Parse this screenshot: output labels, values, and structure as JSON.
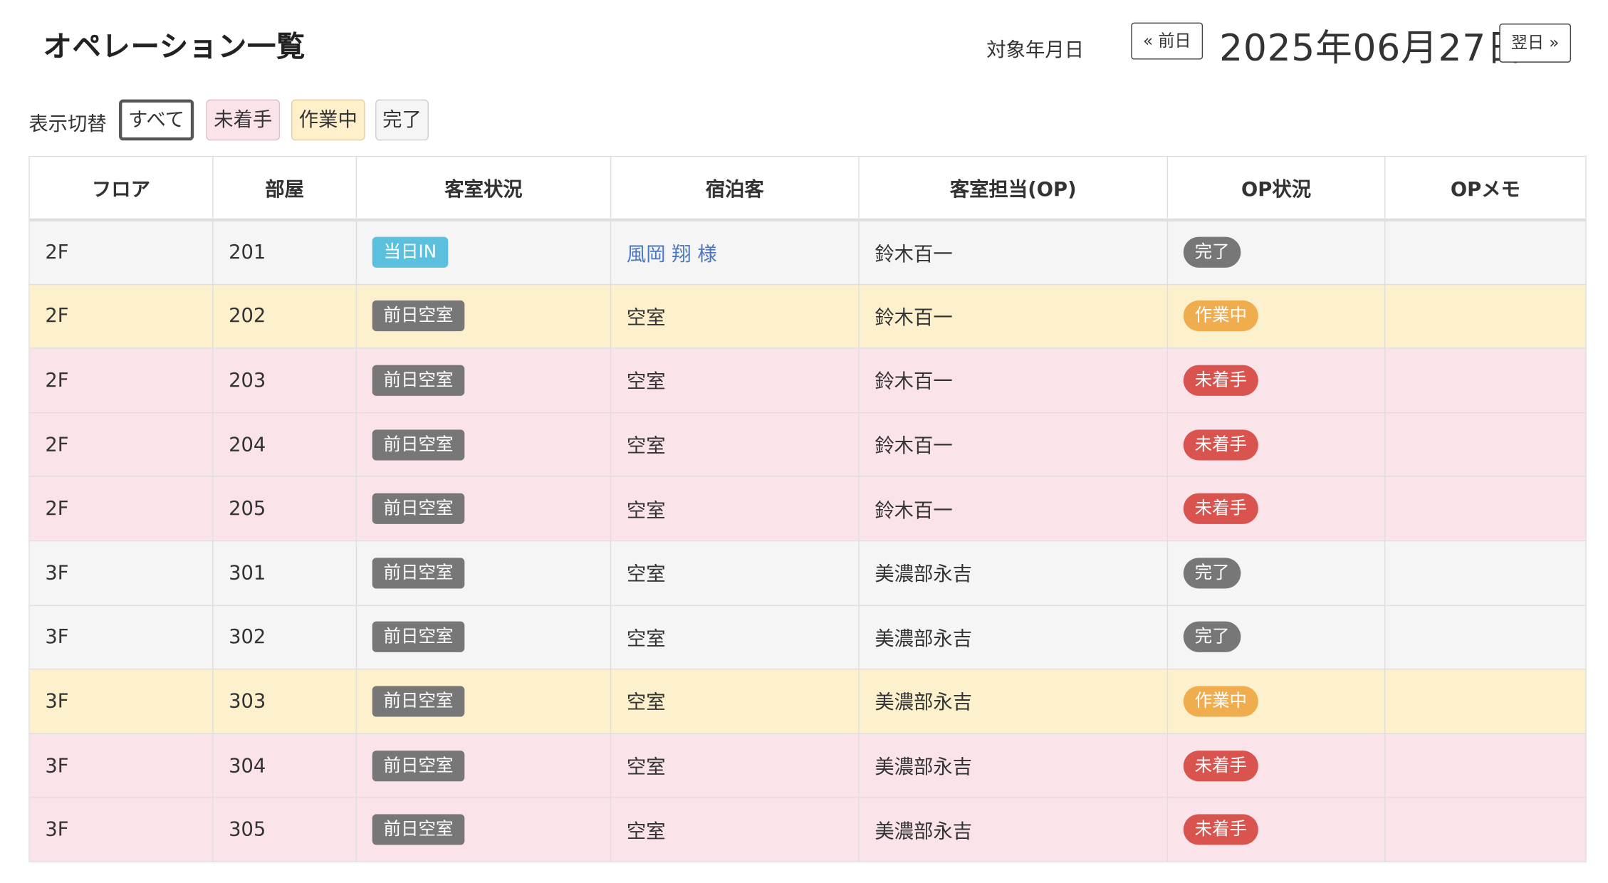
{
  "header": {
    "title": "オペレーション一覧",
    "date_label": "対象年月日",
    "prev_label": "« 前日",
    "date": "2025年06月27日",
    "next_label": "翌日 »"
  },
  "filters": {
    "label": "表示切替",
    "all": "すべて",
    "not_started": "未着手",
    "in_progress": "作業中",
    "done": "完了"
  },
  "table": {
    "headers": [
      "フロア",
      "部屋",
      "客室状況",
      "宿泊客",
      "客室担当(OP)",
      "OP状況",
      "OPメモ"
    ],
    "rows": [
      {
        "floor": "2F",
        "room": "201",
        "room_status": "当日IN",
        "guest": "風岡 翔 様",
        "op": "鈴木百一",
        "op_status": "完了",
        "memo": ""
      },
      {
        "floor": "2F",
        "room": "202",
        "room_status": "前日空室",
        "guest": "空室",
        "op": "鈴木百一",
        "op_status": "作業中",
        "memo": ""
      },
      {
        "floor": "2F",
        "room": "203",
        "room_status": "前日空室",
        "guest": "空室",
        "op": "鈴木百一",
        "op_status": "未着手",
        "memo": ""
      },
      {
        "floor": "2F",
        "room": "204",
        "room_status": "前日空室",
        "guest": "空室",
        "op": "鈴木百一",
        "op_status": "未着手",
        "memo": ""
      },
      {
        "floor": "2F",
        "room": "205",
        "room_status": "前日空室",
        "guest": "空室",
        "op": "鈴木百一",
        "op_status": "未着手",
        "memo": ""
      },
      {
        "floor": "3F",
        "room": "301",
        "room_status": "前日空室",
        "guest": "空室",
        "op": "美濃部永吉",
        "op_status": "完了",
        "memo": ""
      },
      {
        "floor": "3F",
        "room": "302",
        "room_status": "前日空室",
        "guest": "空室",
        "op": "美濃部永吉",
        "op_status": "完了",
        "memo": ""
      },
      {
        "floor": "3F",
        "room": "303",
        "room_status": "前日空室",
        "guest": "空室",
        "op": "美濃部永吉",
        "op_status": "作業中",
        "memo": ""
      },
      {
        "floor": "3F",
        "room": "304",
        "room_status": "前日空室",
        "guest": "空室",
        "op": "美濃部永吉",
        "op_status": "未着手",
        "memo": ""
      },
      {
        "floor": "3F",
        "room": "305",
        "room_status": "前日空室",
        "guest": "空室",
        "op": "美濃部永吉",
        "op_status": "未着手",
        "memo": ""
      }
    ]
  },
  "colors": {
    "status_done": "#777777",
    "status_in_progress": "#f0ad4e",
    "status_not_started": "#d9534f",
    "room_status_in": "#5bc0de",
    "room_status_vacant": "#777777",
    "row_done": "#f5f5f5",
    "row_in_progress": "#fdf1cd",
    "row_not_started": "#fbe3ea",
    "guest_link": "#4a78c2"
  }
}
